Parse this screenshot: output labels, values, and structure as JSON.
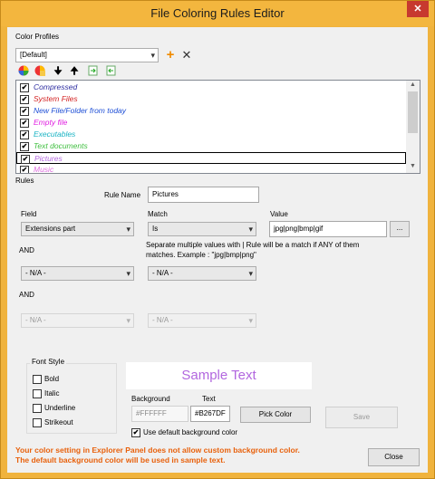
{
  "window": {
    "title": "File Coloring Rules Editor",
    "close_glyph": "✕"
  },
  "profiles": {
    "label": "Color Profiles",
    "selected": "[Default]",
    "add_icon": "plus-icon",
    "delete_icon": "x-icon"
  },
  "toolbar": {
    "icons": [
      "color-wheel-icon",
      "color-wheel-edit-icon",
      "arrow-down-icon",
      "arrow-up-icon",
      "import-icon",
      "export-icon"
    ]
  },
  "rules_list": {
    "items": [
      {
        "label": "Compressed",
        "color": "#2c2ca0",
        "checked": true
      },
      {
        "label": "System Files",
        "color": "#d32222",
        "checked": true
      },
      {
        "label": "New File/Folder from today",
        "color": "#1e4fd6",
        "checked": true
      },
      {
        "label": "Empty file",
        "color": "#e020e0",
        "checked": true
      },
      {
        "label": "Executables",
        "color": "#19b3c3",
        "checked": true
      },
      {
        "label": "Text documents",
        "color": "#3fbf3f",
        "checked": true
      },
      {
        "label": "Pictures",
        "color": "#b267df",
        "checked": true,
        "selected": true
      },
      {
        "label": "Music",
        "color": "#e070e0",
        "checked": true
      }
    ],
    "check_glyph": "✔"
  },
  "rules": {
    "section_label": "Rules",
    "rule_name_label": "Rule Name",
    "rule_name_value": "Pictures",
    "field_label": "Field",
    "match_label": "Match",
    "value_label": "Value",
    "field_value": "Extensions part",
    "match_value": "Is",
    "value_value": "jpg|png|bmp|gif",
    "browse_label": "...",
    "hint": "Separate multiple values with | Rule will be a match if ANY of them matches. Example : \"jpg|bmp|png\"",
    "and1_label": "AND",
    "and2_label": "AND",
    "na_field_1": "- N/A -",
    "na_match_1": "- N/A -",
    "na_field_2": "- N/A -",
    "na_match_2": "- N/A -"
  },
  "font_style": {
    "label": "Font Style",
    "bold": "Bold",
    "italic": "Italic",
    "underline": "Underline",
    "strikeout": "Strikeout"
  },
  "sample": {
    "text": "Sample Text",
    "text_color": "#b267df",
    "background_label": "Background",
    "text_label": "Text",
    "background_value": "#FFFFFF",
    "text_value": "#B267DF",
    "pick_color_label": "Pick Color",
    "save_label": "Save",
    "use_default_bg_label": "Use default background color",
    "use_default_bg_checked": true
  },
  "warning": {
    "line1": "Your color setting in Explorer Panel does not allow custom background color.",
    "line2": "The default background color will be used in sample text."
  },
  "footer": {
    "close_label": "Close"
  }
}
